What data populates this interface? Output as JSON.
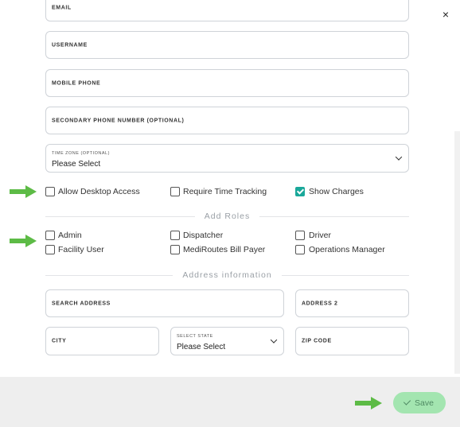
{
  "fields": {
    "email": "EMAIL",
    "username": "USERNAME",
    "mobile_phone": "MOBILE PHONE",
    "secondary_phone": "SECONDARY PHONE NUMBER (OPTIONAL)",
    "time_zone": {
      "label": "TIME ZONE (OPTIONAL)",
      "value": "Please Select"
    },
    "search_address": "SEARCH ADDRESS",
    "address2": "ADDRESS 2",
    "city": "CITY",
    "state": {
      "label": "SELECT STATE",
      "value": "Please Select"
    },
    "zip": "ZIP CODE"
  },
  "options": {
    "allow_desktop": {
      "label": "Allow Desktop Access",
      "checked": false
    },
    "require_time": {
      "label": "Require Time Tracking",
      "checked": false
    },
    "show_charges": {
      "label": "Show Charges",
      "checked": true
    }
  },
  "roles": {
    "title": "Add Roles",
    "items": [
      {
        "label": "Admin",
        "checked": false
      },
      {
        "label": "Dispatcher",
        "checked": false
      },
      {
        "label": "Driver",
        "checked": false
      },
      {
        "label": "Facility User",
        "checked": false
      },
      {
        "label": "MediRoutes Bill Payer",
        "checked": false
      },
      {
        "label": "Operations Manager",
        "checked": false
      }
    ]
  },
  "address_section": {
    "title": "Address information"
  },
  "footer": {
    "save_label": "Save"
  },
  "close_icon": "×",
  "colors": {
    "accent": "#1aa89a",
    "save_bg": "#a3e5b0",
    "arrow": "#5dbb46"
  }
}
